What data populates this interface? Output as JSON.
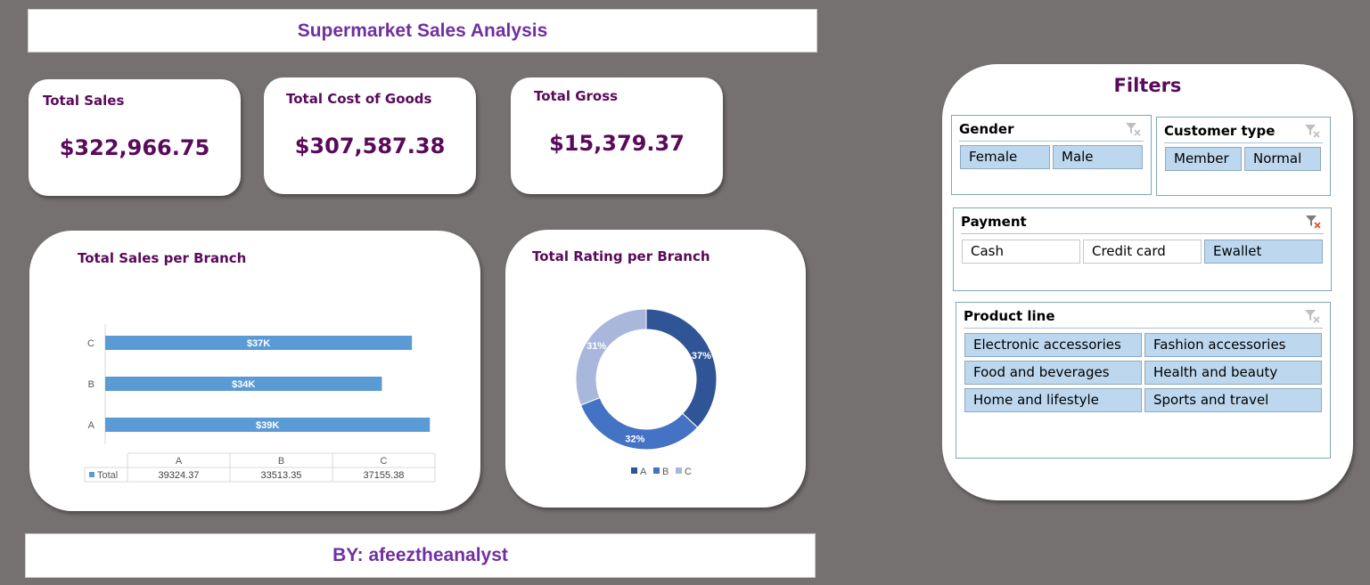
{
  "title": "Supermarket Sales Analysis",
  "footer": "BY: afeeztheanalyst",
  "kpis": {
    "sales": {
      "label": "Total Sales",
      "value": "$322,966.75"
    },
    "cost": {
      "label": "Total Cost of Goods",
      "value": "$307,587.38"
    },
    "gross": {
      "label": "Total Gross",
      "value": "$15,379.37"
    }
  },
  "chart_data": [
    {
      "type": "bar",
      "title": "Total Sales per Branch",
      "orientation": "horizontal",
      "categories": [
        "A",
        "B",
        "C"
      ],
      "values": [
        39324.37,
        33513.35,
        37155.38
      ],
      "data_labels": [
        "$39K",
        "$34K",
        "$37K"
      ],
      "series": [
        {
          "name": "Total",
          "values": [
            39324.37,
            33513.35,
            37155.38
          ]
        }
      ],
      "data_table": {
        "headers": [
          "A",
          "B",
          "C"
        ],
        "rows": [
          {
            "label": "Total",
            "cells": [
              "39324.37",
              "33513.35",
              "37155.38"
            ]
          }
        ]
      },
      "color": "#5b9bd5"
    },
    {
      "type": "pie",
      "variant": "donut",
      "title": "Total Rating per Branch",
      "categories": [
        "A",
        "B",
        "C"
      ],
      "values": [
        37,
        32,
        31
      ],
      "data_labels": [
        "37%",
        "32%",
        "31%"
      ],
      "colors": [
        "#2f5597",
        "#4472c4",
        "#a9b7dc"
      ],
      "legend": "bottom"
    }
  ],
  "filters": {
    "title": "Filters",
    "gender": {
      "label": "Gender",
      "items": [
        "Female",
        "Male"
      ]
    },
    "customer_type": {
      "label": "Customer type",
      "items": [
        "Member",
        "Normal"
      ]
    },
    "payment": {
      "label": "Payment",
      "items": [
        "Cash",
        "Credit card",
        "Ewallet"
      ]
    },
    "product_line": {
      "label": "Product line",
      "items": [
        "Electronic accessories",
        "Fashion accessories",
        "Food and beverages",
        "Health and beauty",
        "Home and lifestyle",
        "Sports and travel"
      ]
    }
  },
  "colors": {
    "accent_purple": "#7030a0",
    "kpi_text": "#5a0a5a",
    "background": "#767171",
    "slicer_selected": "#bdd7ee"
  }
}
